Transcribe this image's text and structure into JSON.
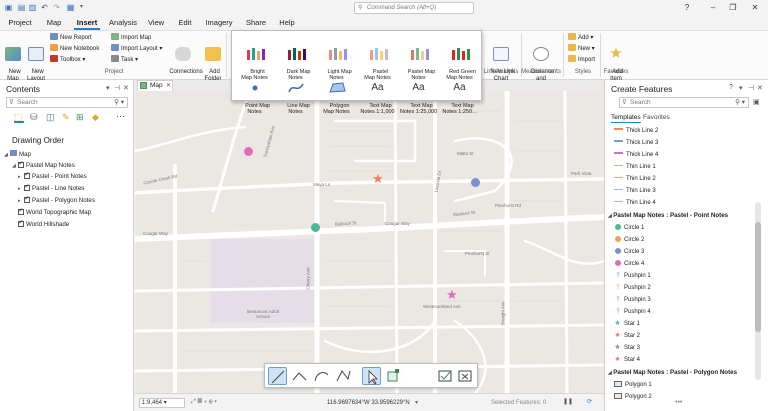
{
  "titlebar": {
    "search_placeholder": "Command Search (Alt+Q)",
    "help": "?",
    "minimize": "–",
    "restore": "❐",
    "close": "✕"
  },
  "menu": {
    "tabs": [
      "Project",
      "Map",
      "Insert",
      "Analysis",
      "View",
      "Edit",
      "Imagery",
      "Share",
      "Help"
    ],
    "active": "Insert"
  },
  "ribbon": {
    "new_map": "New\nMap",
    "new_layout": "New\nLayout",
    "new_report": "New Report",
    "new_notebook": "New Notebook",
    "toolbox": "Toolbox",
    "import_map": "Import Map",
    "import_layout": "Import Layout",
    "task": "Task",
    "connections": "Connections",
    "add_folder": "Add\nFolder",
    "project_group": "Project",
    "new_link_chart": "New Link\nChart",
    "link_analysis_group": "Link Analysis",
    "distance_direction": "Distance and\nDirection",
    "measurements_group": "Measurements",
    "add": "Add",
    "new": "New",
    "import": "Import",
    "styles_group": "Styles",
    "add_item": "Add\nItem",
    "favorites_group": "Favorites"
  },
  "gallery": {
    "row1": [
      "Bright\nMap Notes",
      "Dark Map\nNotes",
      "Light Map\nNotes",
      "Pastel\nMap Notes",
      "Pastel Map\nNotes",
      "Red Green\nMap Notes"
    ],
    "row2": [
      "Point Map\nNotes",
      "Line Map\nNotes",
      "Polygon\nMap Notes",
      "Text Map\nNotes 1:1,000",
      "Text Map\nNotes 1:25,000",
      "Text Map\nNotes 1:250..."
    ],
    "text_glyph": "Aa"
  },
  "contents": {
    "title": "Contents",
    "search_placeholder": "Search",
    "drawing_order": "Drawing Order",
    "layers": [
      {
        "label": "Map",
        "level": 0
      },
      {
        "label": "Pastel Map Notes",
        "level": 1
      },
      {
        "label": "Pastel - Point Notes",
        "level": 2
      },
      {
        "label": "Pastel - Line Notes",
        "level": 2
      },
      {
        "label": "Pastel - Polygon Notes",
        "level": 2
      },
      {
        "label": "World Topographic Map",
        "level": 1
      },
      {
        "label": "World Hillshade",
        "level": 1
      }
    ]
  },
  "map_tab": {
    "label": "Map"
  },
  "map": {
    "streets": [
      "Sunnyslope Ave",
      "Maya Ln",
      "Bailrock St",
      "Malta St",
      "Lacosta Dr",
      "Warland St",
      "Coyote Creek Rd",
      "Cougar Way",
      "Cougar Way",
      "Pinehurst Rd",
      "Pinehurst St",
      "Cherry Ave",
      "Beaumont Adult School",
      "Westmoreland Ave",
      "Straight Ave",
      "Park Vista"
    ]
  },
  "create": {
    "title": "Create Features",
    "search_placeholder": "Search",
    "tab_templates": "Templates",
    "tab_favorites": "Favorites",
    "lines": [
      {
        "label": "Thick Line 2",
        "color": "#f08a5d"
      },
      {
        "label": "Thick Line 3",
        "color": "#6fa3d8"
      },
      {
        "label": "Thick Line 4",
        "color": "#d76fb8"
      },
      {
        "label": "Thin Line 1",
        "color": "#9ac69a"
      },
      {
        "label": "Thin Line 2",
        "color": "#f0a97a"
      },
      {
        "label": "Thin Line 3",
        "color": "#9fb8e0"
      },
      {
        "label": "Thin Line 4",
        "color": "#e4a4cf"
      }
    ],
    "point_group": "Pastel Map Notes : Pastel - Point Notes",
    "points": [
      {
        "label": "Circle 1",
        "color": "#4fb89a",
        "shape": "dot"
      },
      {
        "label": "Circle 2",
        "color": "#f0a050",
        "shape": "dot"
      },
      {
        "label": "Circle 3",
        "color": "#7a90cc",
        "shape": "dot"
      },
      {
        "label": "Circle 4",
        "color": "#e06cb8",
        "shape": "dot"
      },
      {
        "label": "Pushpin 1",
        "color": "#4fb89a",
        "shape": "pin"
      },
      {
        "label": "Pushpin 2",
        "color": "#f0a050",
        "shape": "pin"
      },
      {
        "label": "Pushpin 3",
        "color": "#7a90cc",
        "shape": "pin"
      },
      {
        "label": "Pushpin 4",
        "color": "#e06cb8",
        "shape": "pin"
      },
      {
        "label": "Star 1",
        "color": "#4fb89a",
        "shape": "star"
      },
      {
        "label": "Star 2",
        "color": "#f0804a",
        "shape": "star"
      },
      {
        "label": "Star 3",
        "color": "#7a90cc",
        "shape": "star"
      },
      {
        "label": "Star 4",
        "color": "#e06cb8",
        "shape": "star"
      }
    ],
    "polygon_group": "Pastel Map Notes : Pastel - Polygon Notes",
    "polygons": [
      {
        "label": "Polygon 1",
        "color": "#d9efe6"
      },
      {
        "label": "Polygon 2",
        "color": "#fbe3cf"
      }
    ]
  },
  "status": {
    "scale": "1:9,464",
    "coords": "116.9697634°W 33.9596229°N",
    "selected": "Selected Features: 0"
  }
}
